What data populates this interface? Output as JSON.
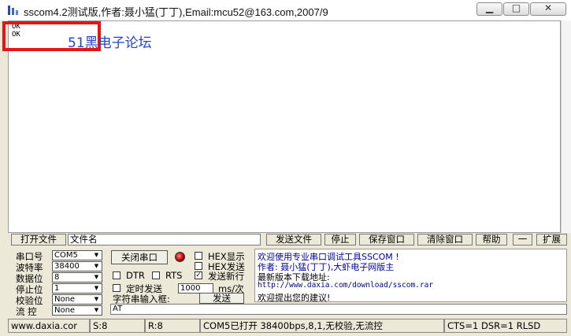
{
  "window": {
    "title": "sscom4.2测试版,作者:聂小猛(丁丁),Email:mcu52@163.com,2007/9",
    "minimize_glyph": "▁",
    "maximize_glyph": "□",
    "close_glyph": "✕"
  },
  "output": {
    "text": "OK\nOK",
    "watermark": "51黑电子论坛"
  },
  "toolbar": {
    "open_file": "打开文件",
    "filename": "文件名",
    "send_file": "发送文件",
    "stop": "停止",
    "save_window": "保存窗口",
    "clear_window": "清除窗口",
    "help": "帮助",
    "dash": "一",
    "expand": "扩展"
  },
  "settings": {
    "port_label": "串口号",
    "port_value": "COM5",
    "baud_label": "波特率",
    "baud_value": "38400",
    "data_label": "数据位",
    "data_value": "8",
    "stop_label": "停止位",
    "stop_value": "1",
    "parity_label": "校验位",
    "parity_value": "None",
    "flow_label": "流 控",
    "flow_value": "None",
    "close_port": "关闭串口",
    "hex_display": "HEX显示",
    "hex_send": "HEX发送",
    "dtr": "DTR",
    "rts": "RTS",
    "send_newline": "发送新行",
    "timed_send": "定时发送",
    "interval_value": "1000",
    "interval_unit": "ms/次",
    "char_input_label": "字符串输入框:",
    "send_button": "发送",
    "send_text": "AT",
    "check_mark": "✓"
  },
  "info": {
    "line1": "欢迎使用专业串口调试工具SSCOM !",
    "line2": "作者: 聂小猛(丁丁),大虾电子网版主",
    "line3": "最新版本下载地址:",
    "line4": "http://www.daxia.com/download/sscom.rar",
    "line5": "欢迎提出您的建议!"
  },
  "status": {
    "site": "www.daxia.cor",
    "sent": "S:8",
    "received": "R:8",
    "port_status": "COM5已打开  38400bps,8,1,无校验,无流控",
    "signals": "CTS=1 DSR=1 RLSD"
  },
  "colors": {
    "highlight_box": "#e81313",
    "watermark": "#2244cc",
    "info_text": "#0000a0"
  }
}
